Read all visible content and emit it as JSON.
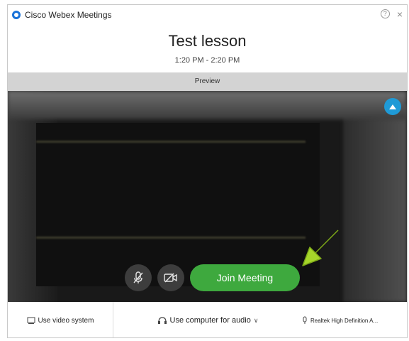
{
  "window": {
    "app_title": "Cisco Webex Meetings",
    "help_glyph": "?",
    "close_glyph": "×"
  },
  "meeting": {
    "title": "Test lesson",
    "time": "1:20 PM - 2:20 PM"
  },
  "preview": {
    "label": "Preview"
  },
  "controls": {
    "join_label": "Join Meeting"
  },
  "bottom": {
    "video_system_label": "Use video system",
    "audio_label": "Use computer for audio",
    "audio_chevron": "∨",
    "mic_label": "Realtek High Definition A..."
  },
  "colors": {
    "join_button": "#3ea93e",
    "preview_badge": "#1f9ad6",
    "arrow": "#a6d62a",
    "logo": "#1a73d9"
  },
  "icons": {
    "app_logo": "webex-logo-icon",
    "help": "help-icon",
    "close": "close-icon",
    "preview_badge": "self-view-icon",
    "mute": "microphone-muted-icon",
    "video_off": "camera-off-icon",
    "video_system": "video-system-icon",
    "audio": "headset-icon",
    "mic": "microphone-icon"
  }
}
